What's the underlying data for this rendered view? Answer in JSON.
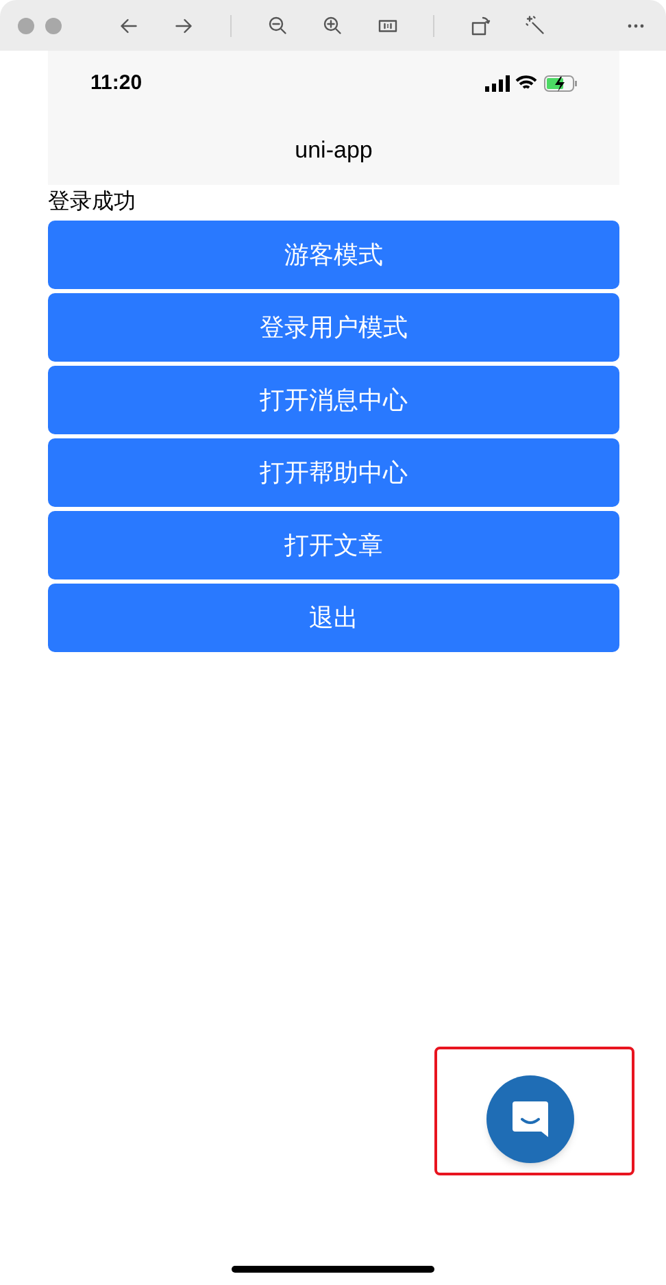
{
  "status_bar": {
    "time": "11:20"
  },
  "nav_bar": {
    "title": "uni-app"
  },
  "message": "登录成功",
  "buttons": [
    "游客模式",
    "登录用户模式",
    "打开消息中心",
    "打开帮助中心",
    "打开文章",
    "退出"
  ],
  "chat_button": {
    "highlighted": true
  }
}
